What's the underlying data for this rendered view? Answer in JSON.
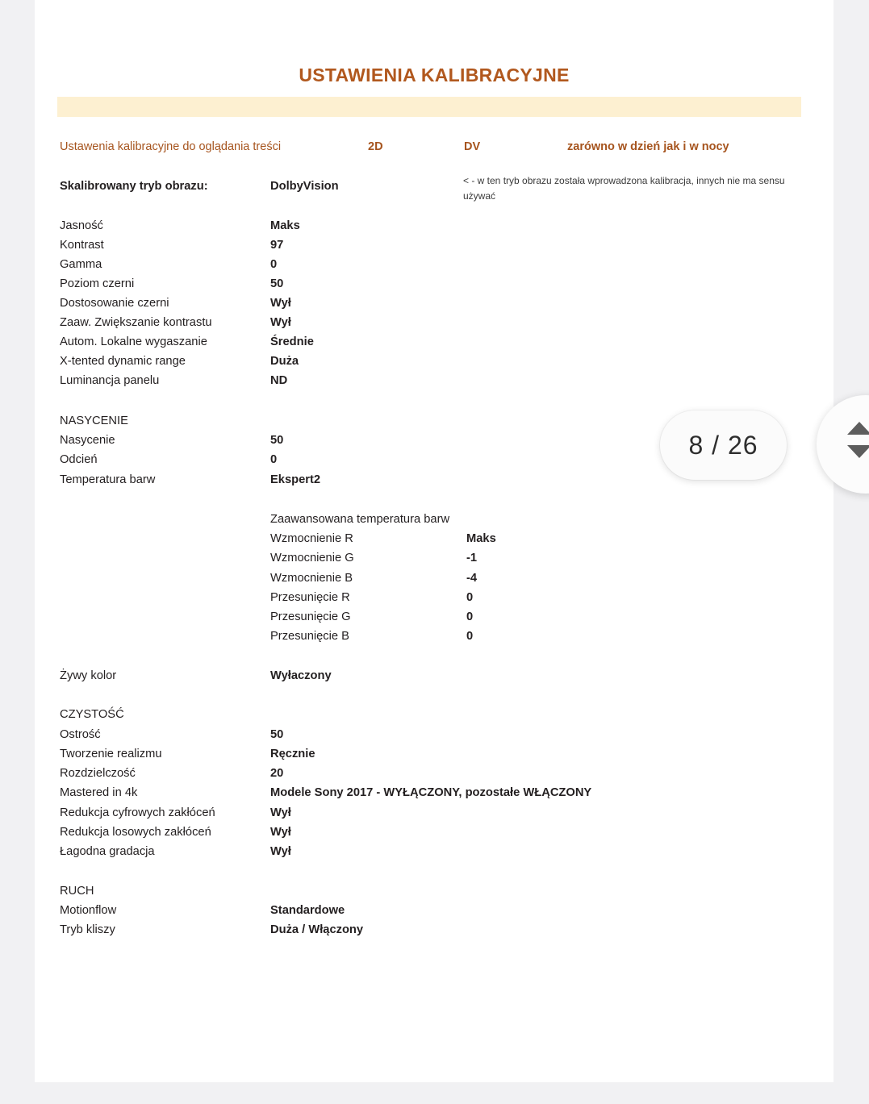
{
  "document": {
    "title": "USTAWIENIA KALIBRACYJNE",
    "accent_color": "#b1581e",
    "band_color": "#fdf0d1"
  },
  "subtitle": {
    "description": "Ustawenia kalibracyjne do oglądania treści",
    "dimension": "2D",
    "format": "DV",
    "condition": "zarówno w dzień jak i w nocy"
  },
  "note": "< - w ten tryb obrazu została wprowadzona kalibracja, innych nie ma sensu używać",
  "settings": {
    "mode": {
      "label": "Skalibrowany tryb obrazu:",
      "value": "DolbyVision"
    },
    "picture": [
      {
        "label": "Jasność",
        "value": "Maks"
      },
      {
        "label": "Kontrast",
        "value": "97"
      },
      {
        "label": "Gamma",
        "value": "0"
      },
      {
        "label": "Poziom czerni",
        "value": "50"
      },
      {
        "label": "Dostosowanie czerni",
        "value": "Wył"
      },
      {
        "label": "Zaaw. Zwiększanie kontrastu",
        "value": "Wył"
      },
      {
        "label": "Autom. Lokalne wygaszanie",
        "value": "Średnie"
      },
      {
        "label": "X-tented dynamic range",
        "value": "Duża"
      },
      {
        "label": "Luminancja panelu",
        "value": "ND"
      }
    ],
    "saturation_heading": "NASYCENIE",
    "saturation": [
      {
        "label": "Nasycenie",
        "value": "50"
      },
      {
        "label": "Odcień",
        "value": "0"
      },
      {
        "label": "Temperatura barw",
        "value": "Ekspert2"
      }
    ],
    "advanced_heading": "Zaawansowana temperatura barw",
    "advanced": [
      {
        "label": "Wzmocnienie R",
        "value": "Maks"
      },
      {
        "label": "Wzmocnienie G",
        "value": "-1"
      },
      {
        "label": "Wzmocnienie B",
        "value": "-4"
      },
      {
        "label": "Przesunięcie R",
        "value": "0"
      },
      {
        "label": "Przesunięcie G",
        "value": "0"
      },
      {
        "label": "Przesunięcie B",
        "value": "0"
      }
    ],
    "vivid": {
      "label": "Żywy kolor",
      "value": "Wyłaczony"
    },
    "clarity_heading": "CZYSTOŚĆ",
    "clarity": [
      {
        "label": "Ostrość",
        "value": "50"
      },
      {
        "label": "Tworzenie realizmu",
        "value": "Ręcznie"
      },
      {
        "label": "Rozdzielczość",
        "value": "20"
      },
      {
        "label": "Mastered in 4k",
        "value": "Modele Sony 2017 - WYŁĄCZONY, pozostałe WŁĄCZONY"
      },
      {
        "label": "Redukcja cyfrowych zakłóceń",
        "value": "Wył"
      },
      {
        "label": "Redukcja losowych zakłóceń",
        "value": "Wył"
      },
      {
        "label": "Łagodna gradacja",
        "value": "Wył"
      }
    ],
    "motion_heading": "RUCH",
    "motion": [
      {
        "label": "Motionflow",
        "value": "Standardowe"
      },
      {
        "label": "Tryb kliszy",
        "value": "Duża / Włączony"
      }
    ]
  },
  "viewer": {
    "page_indicator": "8 / 26",
    "current_page": 8,
    "total_pages": 26,
    "prev_icon": "chevron-up-icon",
    "next_icon": "chevron-down-icon"
  }
}
